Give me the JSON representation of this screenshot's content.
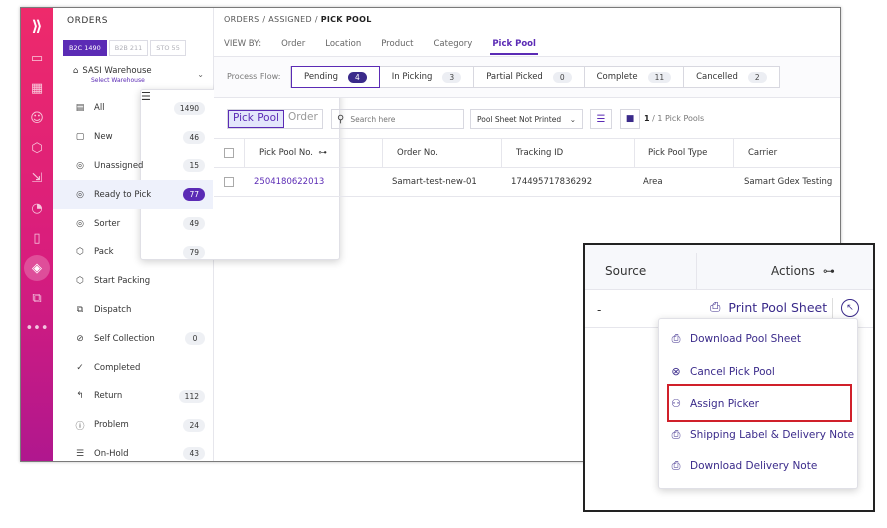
{
  "sidebar": {
    "header": "ORDERS",
    "segments": [
      "B2C 1490",
      "B2B 211",
      "STO 55"
    ],
    "warehouse": {
      "name": "SASI Warehouse",
      "action": "Select Warehouse"
    },
    "items": [
      {
        "label": "All",
        "count": "1490"
      },
      {
        "label": "New",
        "count": "46"
      },
      {
        "label": "Unassigned",
        "count": "15"
      },
      {
        "label": "Ready to Pick",
        "count": "77"
      },
      {
        "label": "Sorter",
        "count": "49"
      },
      {
        "label": "Pack",
        "count": "79"
      },
      {
        "label": "Start Packing",
        "count": ""
      },
      {
        "label": "Dispatch",
        "count": ""
      },
      {
        "label": "Self Collection",
        "count": "0"
      },
      {
        "label": "Completed",
        "count": ""
      },
      {
        "label": "Return",
        "count": "112"
      },
      {
        "label": "Problem",
        "count": "24"
      },
      {
        "label": "On-Hold",
        "count": "43"
      }
    ]
  },
  "breadcrumb": {
    "a": "ORDERS",
    "sep": "/",
    "b": "ASSIGNED",
    "c": "PICK POOL"
  },
  "viewby": {
    "label": "VIEW BY:",
    "tabs": [
      "Order",
      "Location",
      "Product",
      "Category",
      "Pick Pool"
    ]
  },
  "process_flow": {
    "label": "Process Flow:",
    "steps": [
      {
        "label": "Pending",
        "count": "4"
      },
      {
        "label": "In Picking",
        "count": "3"
      },
      {
        "label": "Partial Picked",
        "count": "0"
      },
      {
        "label": "Complete",
        "count": "11"
      },
      {
        "label": "Cancelled",
        "count": "2"
      }
    ]
  },
  "toolbar": {
    "toggle": [
      "Pick Pool",
      "Order"
    ],
    "search_placeholder": "Search here",
    "filter_select": "Pool Sheet Not Printed",
    "count_a": "1",
    "count_b": "/ 1 Pick Pools"
  },
  "table": {
    "headers": [
      "Pick Pool No.",
      "Order No.",
      "Tracking ID",
      "Pick Pool Type",
      "Carrier"
    ],
    "rows": [
      {
        "pick_pool_no": "2504180622013",
        "order_no": "Samart-test-new-01",
        "tracking_id": "174495717836292",
        "type": "Area",
        "carrier": "Samart Gdex Testing"
      }
    ]
  },
  "zoom": {
    "source_header": "Source",
    "actions_header": "Actions",
    "source_value": "-",
    "print_button": "Print Pool Sheet",
    "menu": [
      "Download Pool Sheet",
      "Cancel Pick Pool",
      "Assign Picker",
      "Shipping Label & Delivery Note",
      "Download Delivery Note"
    ]
  },
  "colors": {
    "accent": "#5b2bb5",
    "rail_top": "#ee2a6b",
    "rail_bottom": "#b0178e",
    "highlight": "#d0202a"
  }
}
